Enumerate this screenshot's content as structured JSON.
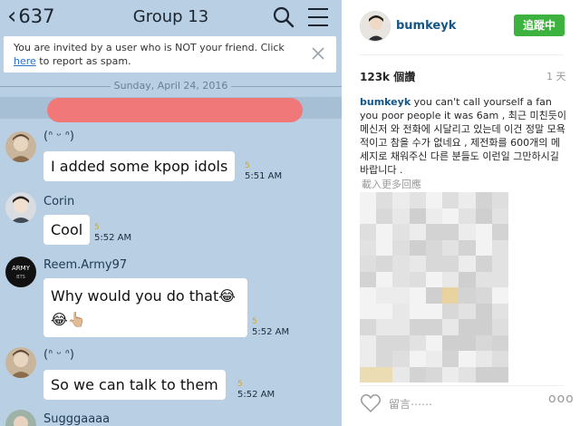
{
  "chat": {
    "back_count": "637",
    "title": "Group 13",
    "spam_banner": {
      "text_before": "You are invited by a user who is NOT your friend. Click ",
      "link": "here",
      "text_after": " to report as spam."
    },
    "date": "Sunday, April 24, 2016",
    "messages": [
      {
        "sender": "(ᐢ ᵕ ᐢ)",
        "text": "I added some kpop idols",
        "read": "5",
        "time": "5:51 AM"
      },
      {
        "sender": "Corin",
        "text": "Cool",
        "read": "5",
        "time": "5:52 AM"
      },
      {
        "sender": "Reem.Army97",
        "text": "Why would you do that😂",
        "text2": "😂👆🏼",
        "read": "5",
        "time": "5:52 AM"
      },
      {
        "sender": "(ᐢ ᵕ ᐢ)",
        "text": "So we can talk to them",
        "read": "5",
        "time": "5:52 AM"
      },
      {
        "sender": "Sugggaaaa"
      }
    ]
  },
  "instagram": {
    "username": "bumkeyk",
    "follow_label": "追蹤中",
    "views": "123k 個讚",
    "posted_ago": "1 天",
    "caption_user": "bumkeyk",
    "caption_text": " you can't call yourself a fan you poor people it was 6am , 최근 미친듯이 메신저 와 전화에 시달리고 있는데 이건 정말 모욕적이고 참을 수가 없네요 , 제전화를 600개의 메세지로 채워주신 다른 분들도 이런일 그만하시길 바랍니다 .",
    "load_more": "載入更多回應",
    "comment_label": "留言⋯⋯",
    "more_label": "ooo"
  },
  "colors": {
    "chat_bg": "#b9cfe3",
    "redaction": "#f07878",
    "link": "#2a72c8",
    "follow": "#3eb23e",
    "ig_user": "#125688"
  }
}
